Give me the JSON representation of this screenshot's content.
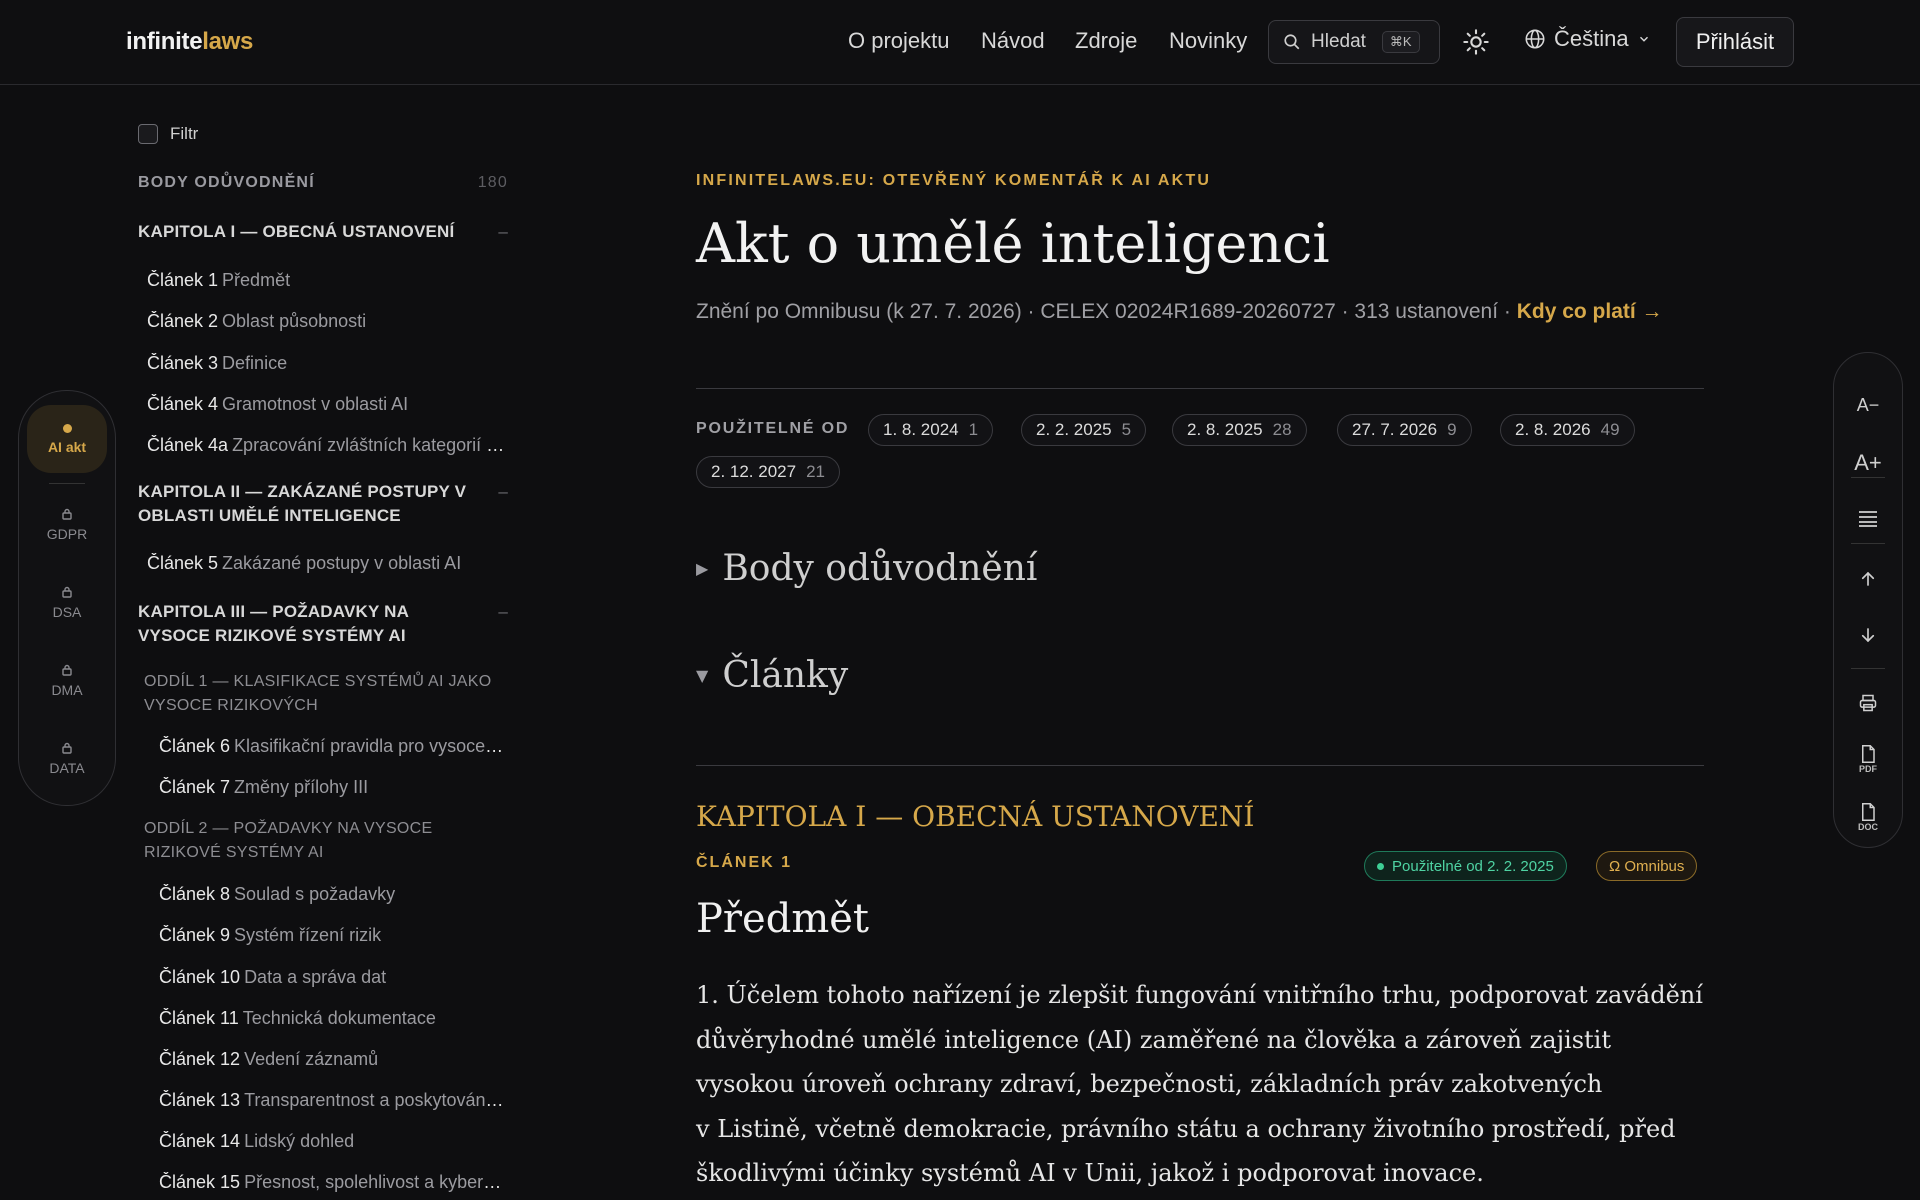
{
  "header": {
    "logo_part1": "infinite",
    "logo_part2": "laws",
    "nav": [
      "O projektu",
      "Návod",
      "Zdroje",
      "Novinky"
    ],
    "search_label": "Hledat",
    "search_shortcut": "⌘K",
    "language": "Čeština",
    "login_label": "Přihlásit"
  },
  "switcher": {
    "items": [
      {
        "label": "AI akt",
        "active": true
      },
      {
        "label": "GDPR",
        "locked": true
      },
      {
        "label": "DSA",
        "locked": true
      },
      {
        "label": "DMA",
        "locked": true
      },
      {
        "label": "DATA",
        "locked": true
      }
    ]
  },
  "toc": {
    "filter_label": "Filtr",
    "recitals_label": "BODY ODŮVODNĚNÍ",
    "recitals_count": "180",
    "collapse_symbol": "–",
    "chapter1": "KAPITOLA I — OBECNÁ USTANOVENÍ",
    "chapter2": "KAPITOLA II — ZAKÁZANÉ POSTUPY V OBLASTI UMĚLÉ INTELIGENCE",
    "chapter3": "KAPITOLA III — POŽADAVKY NA VYSOCE RIZIKOVÉ SYSTÉMY AI",
    "section1": "ODDÍL 1 — KLASIFIKACE SYSTÉMŮ AI JAKO VYSOCE RIZIKOVÝCH",
    "section2": "ODDÍL 2 — POŽADAVKY NA VYSOCE RIZIKOVÉ SYSTÉMY AI",
    "articles": [
      {
        "num": "Článek 1",
        "title": "Předmět"
      },
      {
        "num": "Článek 2",
        "title": "Oblast působnosti"
      },
      {
        "num": "Článek 3",
        "title": "Definice"
      },
      {
        "num": "Článek 4",
        "title": "Gramotnost v oblasti AI"
      },
      {
        "num": "Článek 4a",
        "title": "Zpracování zvláštních kategorií osobních údajů"
      },
      {
        "num": "Článek 5",
        "title": "Zakázané postupy v oblasti AI"
      },
      {
        "num": "Článek 6",
        "title": "Klasifikační pravidla pro vysoce rizikové systémy AI"
      },
      {
        "num": "Článek 7",
        "title": "Změny přílohy III"
      },
      {
        "num": "Článek 8",
        "title": "Soulad s požadavky"
      },
      {
        "num": "Článek 9",
        "title": "Systém řízení rizik"
      },
      {
        "num": "Článek 10",
        "title": "Data a správa dat"
      },
      {
        "num": "Článek 11",
        "title": "Technická dokumentace"
      },
      {
        "num": "Článek 12",
        "title": "Vedení záznamů"
      },
      {
        "num": "Článek 13",
        "title": "Transparentnost a poskytování informací"
      },
      {
        "num": "Článek 14",
        "title": "Lidský dohled"
      },
      {
        "num": "Článek 15",
        "title": "Přesnost, spolehlivost a kybernetická bezpečnost"
      }
    ]
  },
  "main": {
    "eyebrow": "INFINITELAWS.EU: OTEVŘENÝ KOMENTÁŘ K AI AKTU",
    "title": "Akt o umělé inteligenci",
    "subline": "Znění po Omnibusu (k 27. 7. 2026) · CELEX 02024R1689-20260727 · 313 ustanovení ·",
    "subline_link": "Kdy co platí →",
    "dates_label": "POUŽITELNÉ OD",
    "dates": [
      {
        "date": "1. 8. 2024",
        "count": "1"
      },
      {
        "date": "2. 2. 2025",
        "count": "5"
      },
      {
        "date": "2. 8. 2025",
        "count": "28"
      },
      {
        "date": "27. 7. 2026",
        "count": "9"
      },
      {
        "date": "2. 8. 2026",
        "count": "49"
      },
      {
        "date": "2. 12. 2027",
        "count": "21"
      }
    ],
    "recitals_toggle": "Body odůvodnění",
    "articles_toggle": "Články",
    "chapter_heading": "KAPITOLA I — OBECNÁ USTANOVENÍ",
    "article_label": "ČLÁNEK 1",
    "badge_applicable": "Použitelné od 2. 2. 2025",
    "badge_omnibus": "Ω Omnibus",
    "article_title": "Předmět",
    "paragraph_lines": [
      "1.  Účelem tohoto nařízení je zlepšit fungování vnitřního trhu, podporovat zavádění",
      "důvěryhodné umělé inteligence (AI) zaměřené na člověka a zároveň zajistit",
      "vysokou úroveň ochrany zdraví, bezpečnosti, základních práv zakotvených",
      "v Listině, včetně demokracie, právního státu a ochrany životního prostředí, před",
      "škodlivými účinky systémů AI v Unii, jakož i podporovat inovace."
    ]
  },
  "tools": {
    "font_smaller": "A−",
    "font_larger": "A+",
    "pdf_label": "PDF",
    "doc_label": "DOC"
  }
}
